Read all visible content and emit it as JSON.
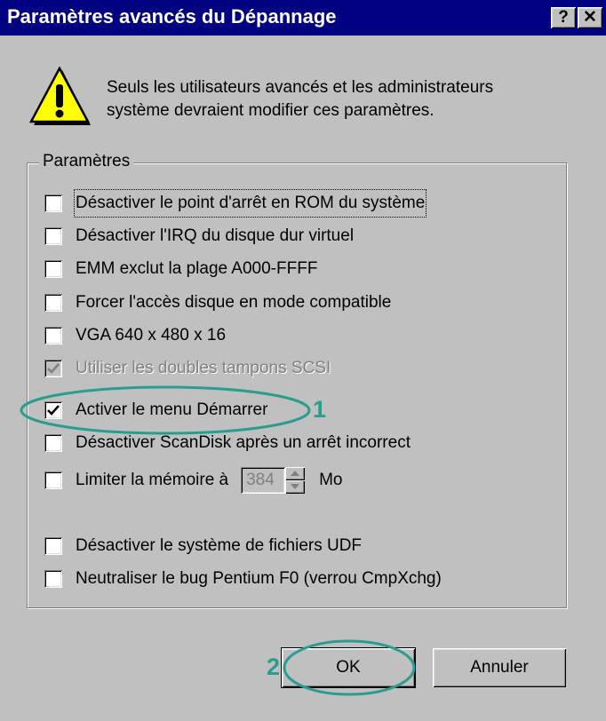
{
  "window": {
    "title": "Paramètres avancés du Dépannage",
    "help_button": "?",
    "close_button": "✕"
  },
  "warning": {
    "icon": "warning-icon",
    "line1": "Seuls les utilisateurs avancés et les administrateurs",
    "line2": "système devraient modifier ces paramètres."
  },
  "group": {
    "label": "Paramètres"
  },
  "checkboxes": [
    {
      "label": "Désactiver le point d'arrêt en ROM du système",
      "checked": false,
      "disabled": false,
      "focused": true
    },
    {
      "label": "Désactiver l'IRQ du disque dur virtuel",
      "checked": false,
      "disabled": false
    },
    {
      "label": "EMM exclut la plage A000-FFFF",
      "checked": false,
      "disabled": false
    },
    {
      "label": "Forcer l'accès disque en mode compatible",
      "checked": false,
      "disabled": false
    },
    {
      "label": "VGA 640 x 480 x 16",
      "checked": false,
      "disabled": false
    },
    {
      "label": "Utiliser les doubles tampons SCSI",
      "checked": true,
      "disabled": true
    },
    {
      "label": "Activer le menu Démarrer",
      "checked": true,
      "disabled": false
    },
    {
      "label": "Désactiver ScanDisk après un arrêt incorrect",
      "checked": false,
      "disabled": false
    },
    {
      "label": "Limiter la mémoire à",
      "checked": false,
      "disabled": false
    },
    {
      "label": "Désactiver le système de fichiers UDF",
      "checked": false,
      "disabled": false
    },
    {
      "label": "Neutraliser le bug Pentium F0 (verrou CmpXchg)",
      "checked": false,
      "disabled": false
    }
  ],
  "memory_limit": {
    "value": "384",
    "unit": "Mo"
  },
  "buttons": {
    "ok": "OK",
    "cancel": "Annuler"
  },
  "annotations": {
    "color": "#2a9d8f",
    "marker1": "1",
    "marker2": "2"
  }
}
